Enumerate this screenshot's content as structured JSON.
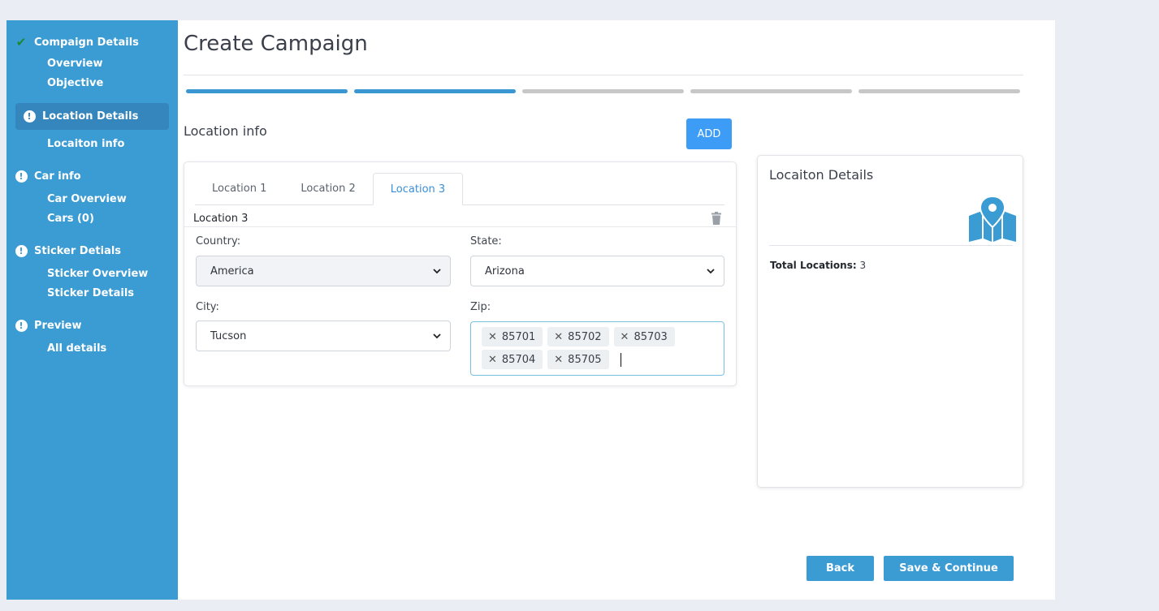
{
  "sidebar": {
    "groups": [
      {
        "title": "Compaign Details",
        "status": "done",
        "items": [
          "Overview",
          "Objective"
        ]
      },
      {
        "title": "Location Details",
        "status": "warning",
        "active": true,
        "items": [
          "Locaiton info"
        ]
      },
      {
        "title": "Car info",
        "status": "warning",
        "items": [
          "Car Overview",
          "Cars (0)"
        ]
      },
      {
        "title": "Sticker Detials",
        "status": "warning",
        "items": [
          "Sticker Overview",
          "Sticker Details"
        ]
      },
      {
        "title": "Preview",
        "status": "warning",
        "items": [
          "All details"
        ]
      }
    ],
    "icons": {
      "done": "check-icon",
      "warning": "exclamation-circle-icon"
    }
  },
  "header": {
    "title": "Create Campaign"
  },
  "progress": {
    "total_steps": 5,
    "completed_steps": 2
  },
  "location_info": {
    "title": "Location info",
    "add_label": "ADD",
    "tabs": [
      "Location 1",
      "Location 2",
      "Location 3"
    ],
    "active_tab": 2,
    "current_location_name": "Location 3",
    "fields": {
      "country": {
        "label": "Country:",
        "value": "America",
        "disabled": true
      },
      "state": {
        "label": "State:",
        "value": "Arizona"
      },
      "city": {
        "label": "City:",
        "value": "Tucson"
      },
      "zip": {
        "label": "Zip:",
        "values": [
          "85701",
          "85702",
          "85703",
          "85704",
          "85705"
        ]
      }
    }
  },
  "details_panel": {
    "title": "Locaiton Details",
    "total_label": "Total Locations:",
    "total_value": "3"
  },
  "footer": {
    "back_label": "Back",
    "save_label": "Save & Continue"
  },
  "colors": {
    "sidebar": "#3b9bd3",
    "accent": "#3d9cf5",
    "progress_done": "#3a97d2",
    "progress_todo": "#c7c7c7",
    "check": "#1c8a34"
  }
}
